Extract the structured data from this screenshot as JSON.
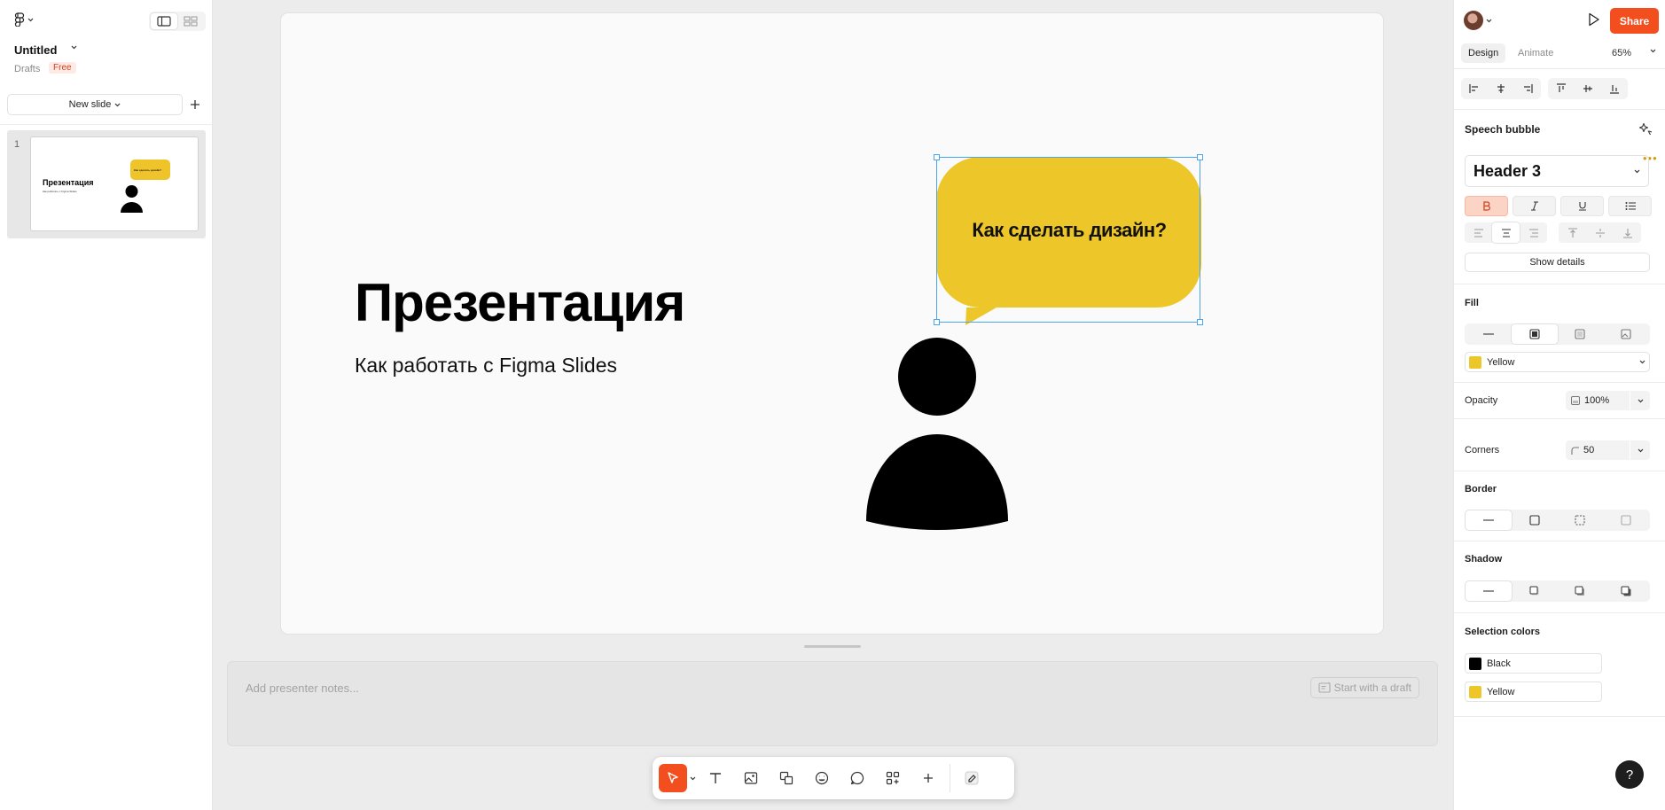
{
  "app": {
    "file_title": "Untitled",
    "location": "Drafts",
    "plan_badge": "Free"
  },
  "left_panel": {
    "new_slide_label": "New slide",
    "slides": [
      {
        "number": "1",
        "title": "Презентация",
        "subtitle": "Как работать с Figma Slides",
        "bubble_text": "Как сделать дизайн?"
      }
    ]
  },
  "slide": {
    "title": "Презентация",
    "subtitle": "Как работать с Figma Slides",
    "bubble_text": "Как сделать дизайн?"
  },
  "notes": {
    "placeholder": "Add presenter notes...",
    "start_draft_label": "Start with a draft"
  },
  "toolbar": {
    "tools": [
      "move-icon",
      "text-icon",
      "image-icon",
      "shapes-icon",
      "stamp-icon",
      "comment-icon",
      "assets-icon",
      "plus-icon",
      "draw-icon"
    ]
  },
  "right_panel": {
    "share_label": "Share",
    "tabs": [
      "Design",
      "Animate"
    ],
    "zoom": "65%",
    "element_name": "Speech bubble",
    "text_style": "Header 3",
    "show_details_label": "Show details",
    "fill": {
      "label": "Fill",
      "color_name": "Yellow",
      "color_hex": "#EDC72A"
    },
    "opacity": {
      "label": "Opacity",
      "value": "100%"
    },
    "corners": {
      "label": "Corners",
      "value": "50"
    },
    "border": {
      "label": "Border"
    },
    "shadow": {
      "label": "Shadow"
    },
    "selection_colors": {
      "label": "Selection colors",
      "items": [
        {
          "name": "Black",
          "hex": "#000000"
        },
        {
          "name": "Yellow",
          "hex": "#EDC72A"
        }
      ]
    },
    "help_label": "?"
  },
  "colors": {
    "accent": "#F24E1E",
    "selection": "#4AA5F0",
    "bubble": "#EDC72A"
  }
}
